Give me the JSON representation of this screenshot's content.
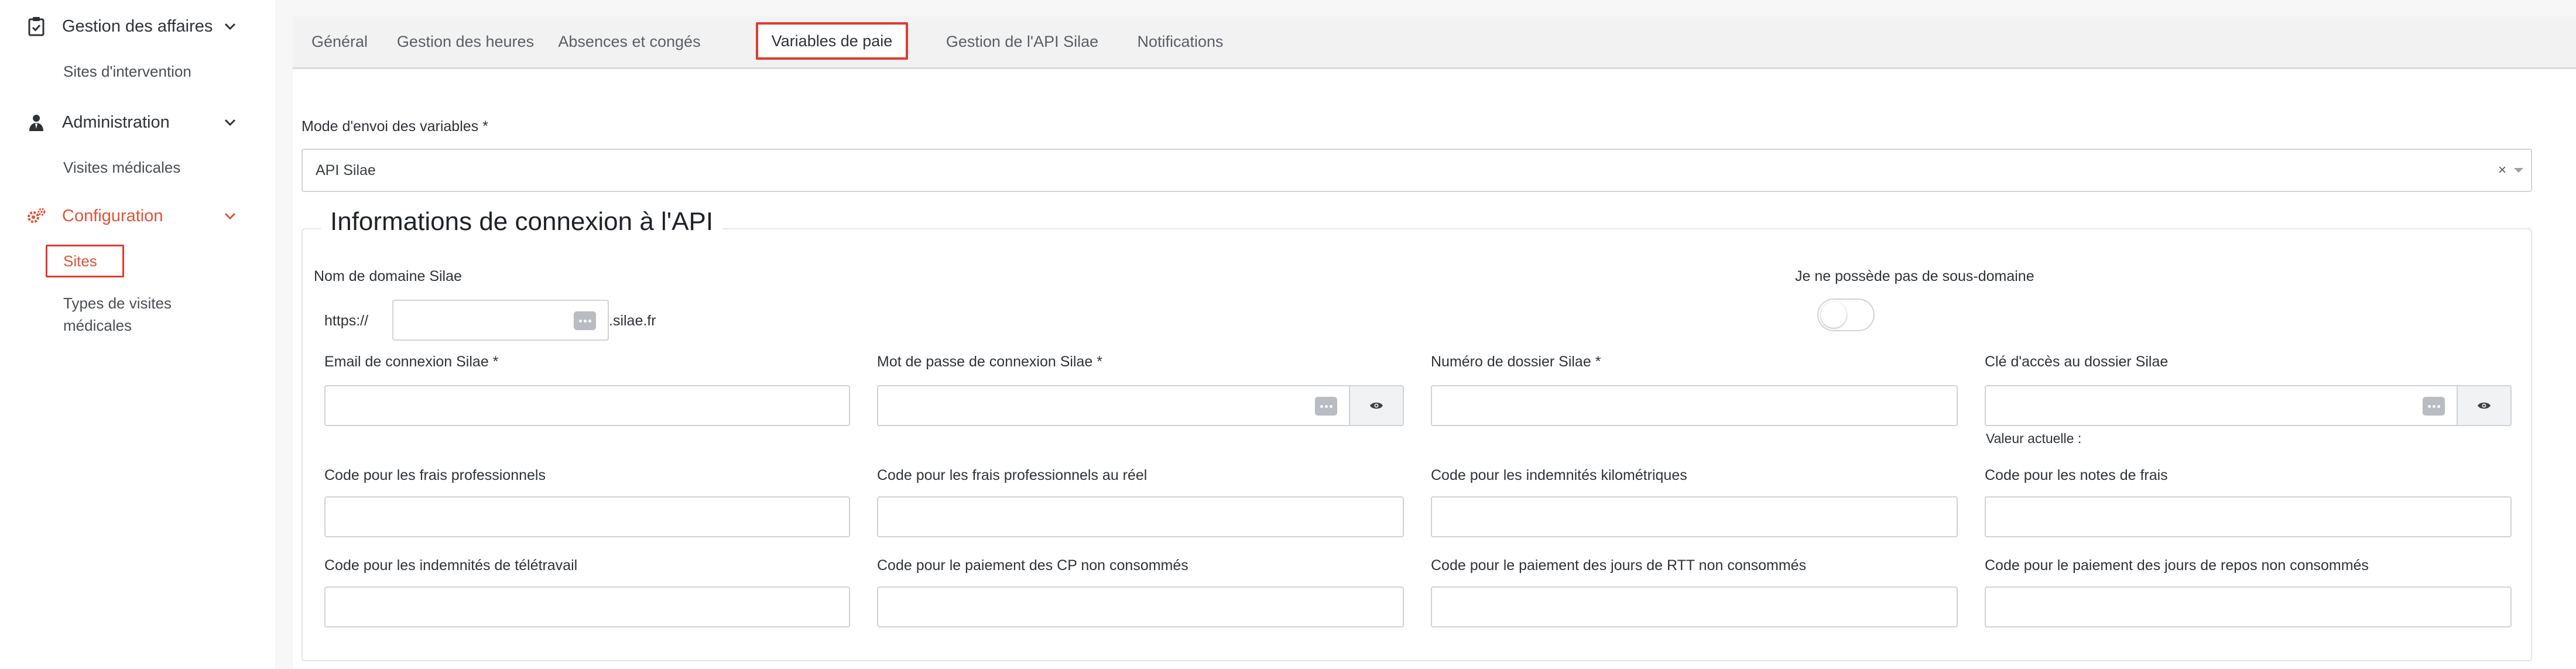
{
  "sidebar": {
    "groups": [
      {
        "label": "Gestion des affaires",
        "icon": "clipboard-check-icon",
        "sub": [
          "Sites d'intervention"
        ]
      },
      {
        "label": "Administration",
        "icon": "user-tie-icon",
        "sub": [
          "Visites médicales"
        ]
      },
      {
        "label": "Configuration",
        "icon": "gears-icon",
        "sub": [
          "Sites",
          "Types de visites",
          "médicales"
        ]
      }
    ],
    "accent_color": "#e1533a"
  },
  "tabs": [
    "Général",
    "Gestion des heures",
    "Absences et congés",
    "Variables de paie",
    "Gestion de l'API Silae",
    "Notifications"
  ],
  "active_tab": "Variables de paie",
  "form": {
    "mode_label": "Mode d'envoi des variables *",
    "mode_value": "API Silae",
    "mode_clear": "×",
    "fieldset_title": "Informations de connexion à l'API",
    "domain_label": "Nom de domaine Silae",
    "domain_prefix": "https://",
    "domain_suffix": ".silae.fr",
    "no_subdomain_label": "Je ne possède pas de sous-domaine",
    "email_label": "Email de connexion Silae *",
    "password_label": "Mot de passe de connexion Silae *",
    "dossier_label": "Numéro de dossier Silae *",
    "access_key_label": "Clé d'accès au dossier Silae",
    "current_value_label": "Valeur actuelle :",
    "codes": [
      "Code pour les frais professionnels",
      "Code pour les frais professionnels au réel",
      "Code pour les indemnités kilométriques",
      "Code pour les notes de frais",
      "Code pour les indemnités de télétravail",
      "Code pour le paiement des CP non consommés",
      "Code pour le paiement des jours de RTT non consommés",
      "Code pour le paiement des jours de repos non consommés"
    ]
  }
}
